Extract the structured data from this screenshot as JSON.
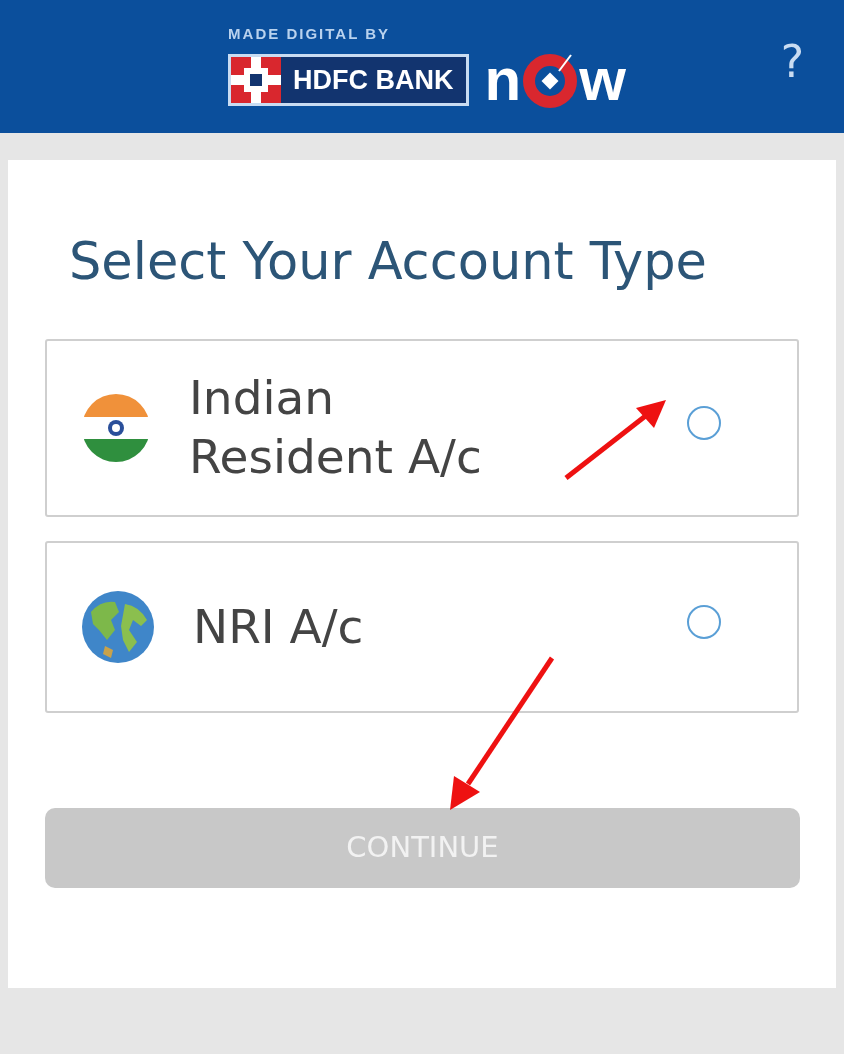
{
  "header": {
    "tagline": "MADE DIGITAL BY",
    "bank_name": "HDFC BANK",
    "logo_start": "n",
    "logo_end": "w",
    "help": "?"
  },
  "title": "Select Your Account Type",
  "options": [
    {
      "kind": "india",
      "label": "Indian Resident A/c",
      "selected": false
    },
    {
      "kind": "globe",
      "label": "NRI A/c",
      "selected": false
    }
  ],
  "continue_button": {
    "label": "CONTINUE",
    "disabled": true
  }
}
